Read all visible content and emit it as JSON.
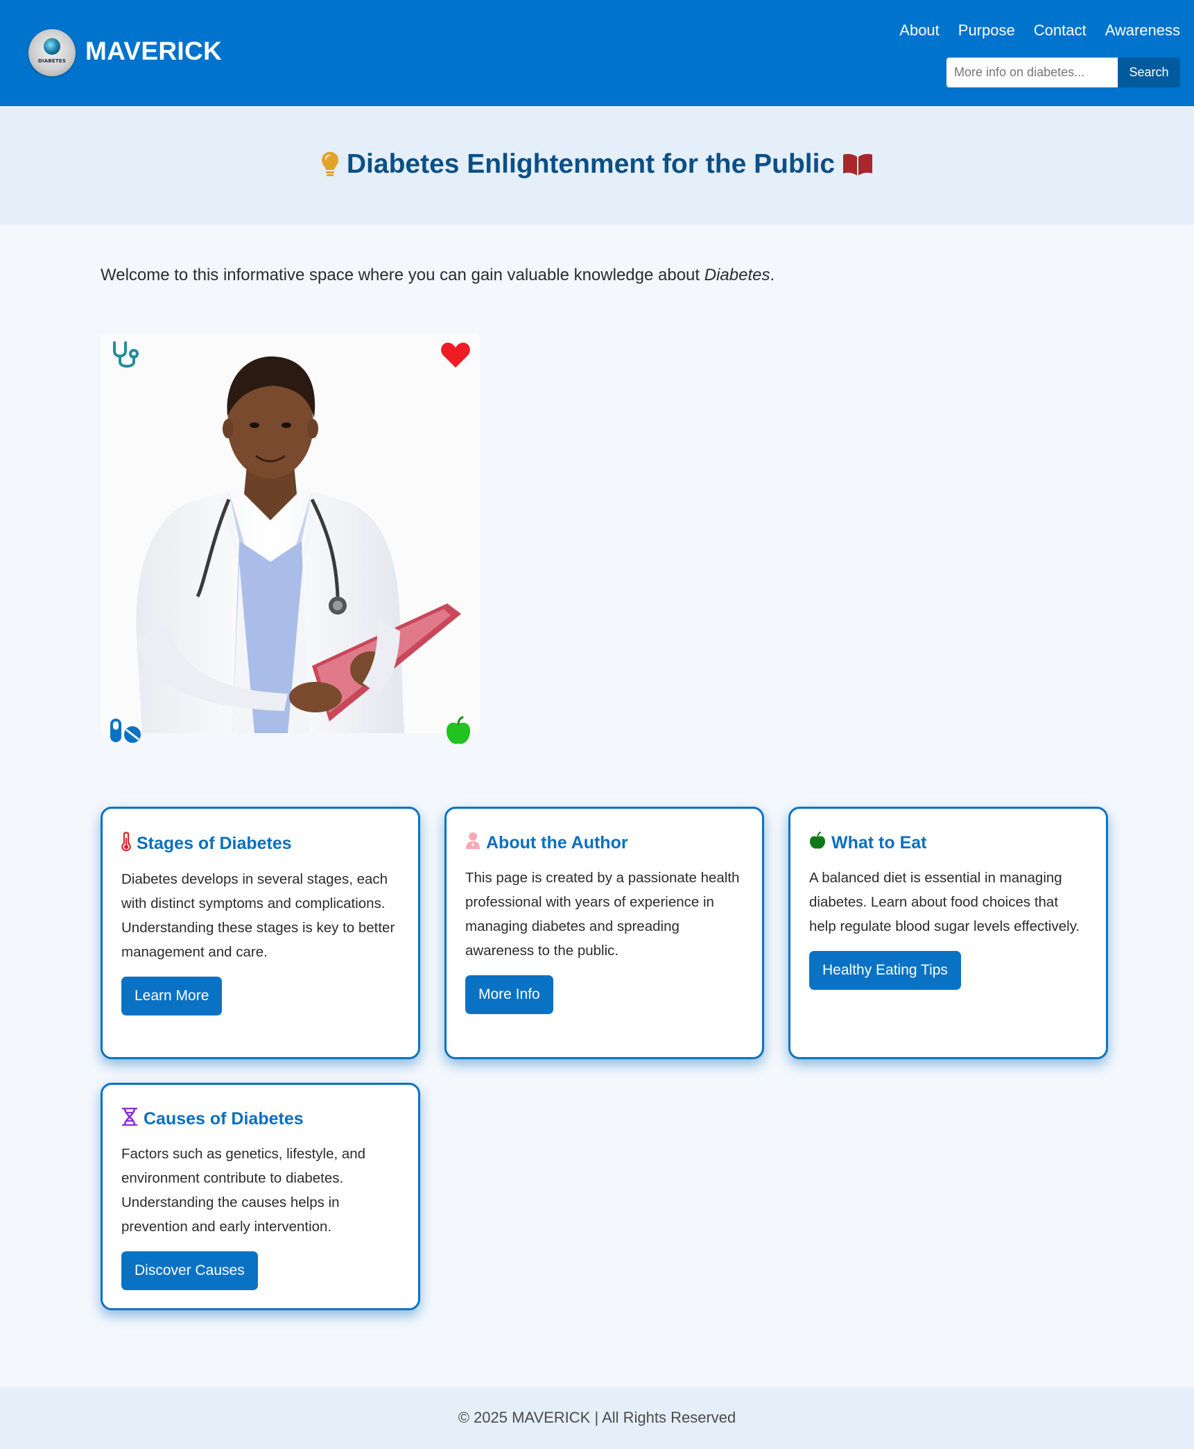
{
  "header": {
    "brand": "MAVERICK",
    "logo_text": "DIABETES",
    "nav": [
      "About",
      "Purpose",
      "Contact",
      "Awareness"
    ],
    "search": {
      "placeholder": "More info on diabetes...",
      "value": "",
      "button_label": "Search"
    }
  },
  "hero": {
    "title": "Diabetes Enlightenment for the Public",
    "icons": [
      "lightbulb-icon",
      "open-book-icon"
    ]
  },
  "intro": {
    "text": "Welcome to this informative space where you can gain valuable knowledge about ",
    "emphasis": "Diabetes",
    "end": "."
  },
  "image": {
    "description_icons": [
      "stethoscope-icon",
      "heart-icon",
      "pills-icon",
      "apple-icon"
    ]
  },
  "cards": [
    {
      "icon": "thermometer-icon",
      "title": "Stages of Diabetes",
      "body": "Diabetes develops in several stages, each with distinct symptoms and complications. Understanding these stages is key to better management and care.",
      "button": "Learn More"
    },
    {
      "icon": "user-doctor-icon",
      "title": "About the Author",
      "body": "This page is created by a passionate health professional with years of experience in managing diabetes and spreading awareness to the public.",
      "button": "More Info"
    },
    {
      "icon": "apple-icon",
      "title": "What to Eat",
      "body": "A balanced diet is essential in managing diabetes. Learn about food choices that help regulate blood sugar levels effectively.",
      "button": "Healthy Eating Tips"
    },
    {
      "icon": "dna-icon",
      "title": "Causes of Diabetes",
      "body": "Factors such as genetics, lifestyle, and environment contribute to diabetes. Understanding the causes helps in prevention and early intervention.",
      "button": "Discover Causes"
    }
  ],
  "footer": {
    "text": "© 2025 MAVERICK | All Rights Reserved"
  },
  "colors": {
    "header_bg": "#0073cc",
    "hero_bg": "#e5eff9",
    "page_bg": "#f4f8fc",
    "accent": "#0a72c4",
    "title_blue": "#0b4f86",
    "search_button": "#005a9e"
  }
}
